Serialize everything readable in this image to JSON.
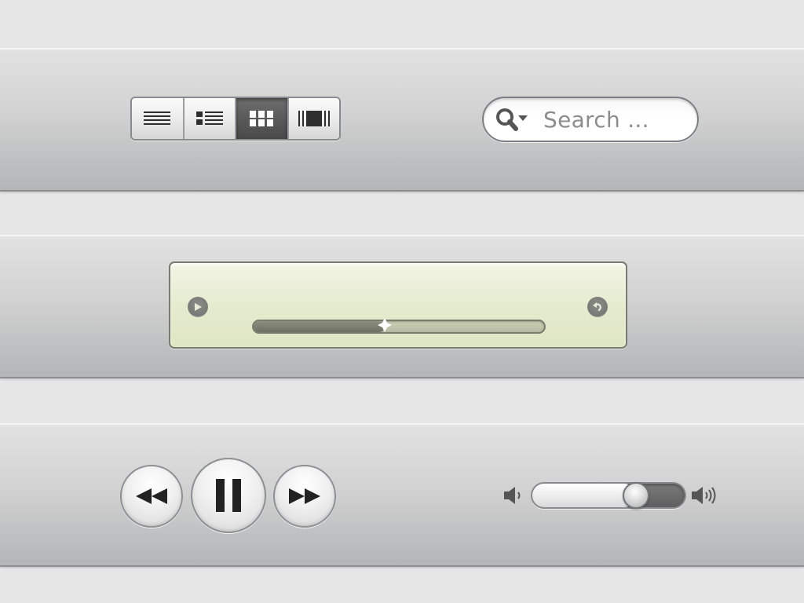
{
  "view_switcher": {
    "options": [
      {
        "icon": "list-view-icon",
        "active": false
      },
      {
        "icon": "detailed-list-view-icon",
        "active": false
      },
      {
        "icon": "grid-view-icon",
        "active": true
      },
      {
        "icon": "cover-flow-view-icon",
        "active": false
      }
    ]
  },
  "search": {
    "placeholder": "Search ...",
    "icon": "search-icon"
  },
  "display": {
    "left_button_icon": "play-icon",
    "right_button_icon": "repeat-icon",
    "progress": 0.45
  },
  "transport": {
    "rewind_icon": "rewind-icon",
    "pause_icon": "pause-icon",
    "forward_icon": "fast-forward-icon"
  },
  "volume": {
    "level": 0.68,
    "min_icon": "volume-low-icon",
    "max_icon": "volume-high-icon"
  },
  "colors": {
    "lcd_background": "#e5ebcf",
    "active_segment": "#5a5a5a"
  }
}
